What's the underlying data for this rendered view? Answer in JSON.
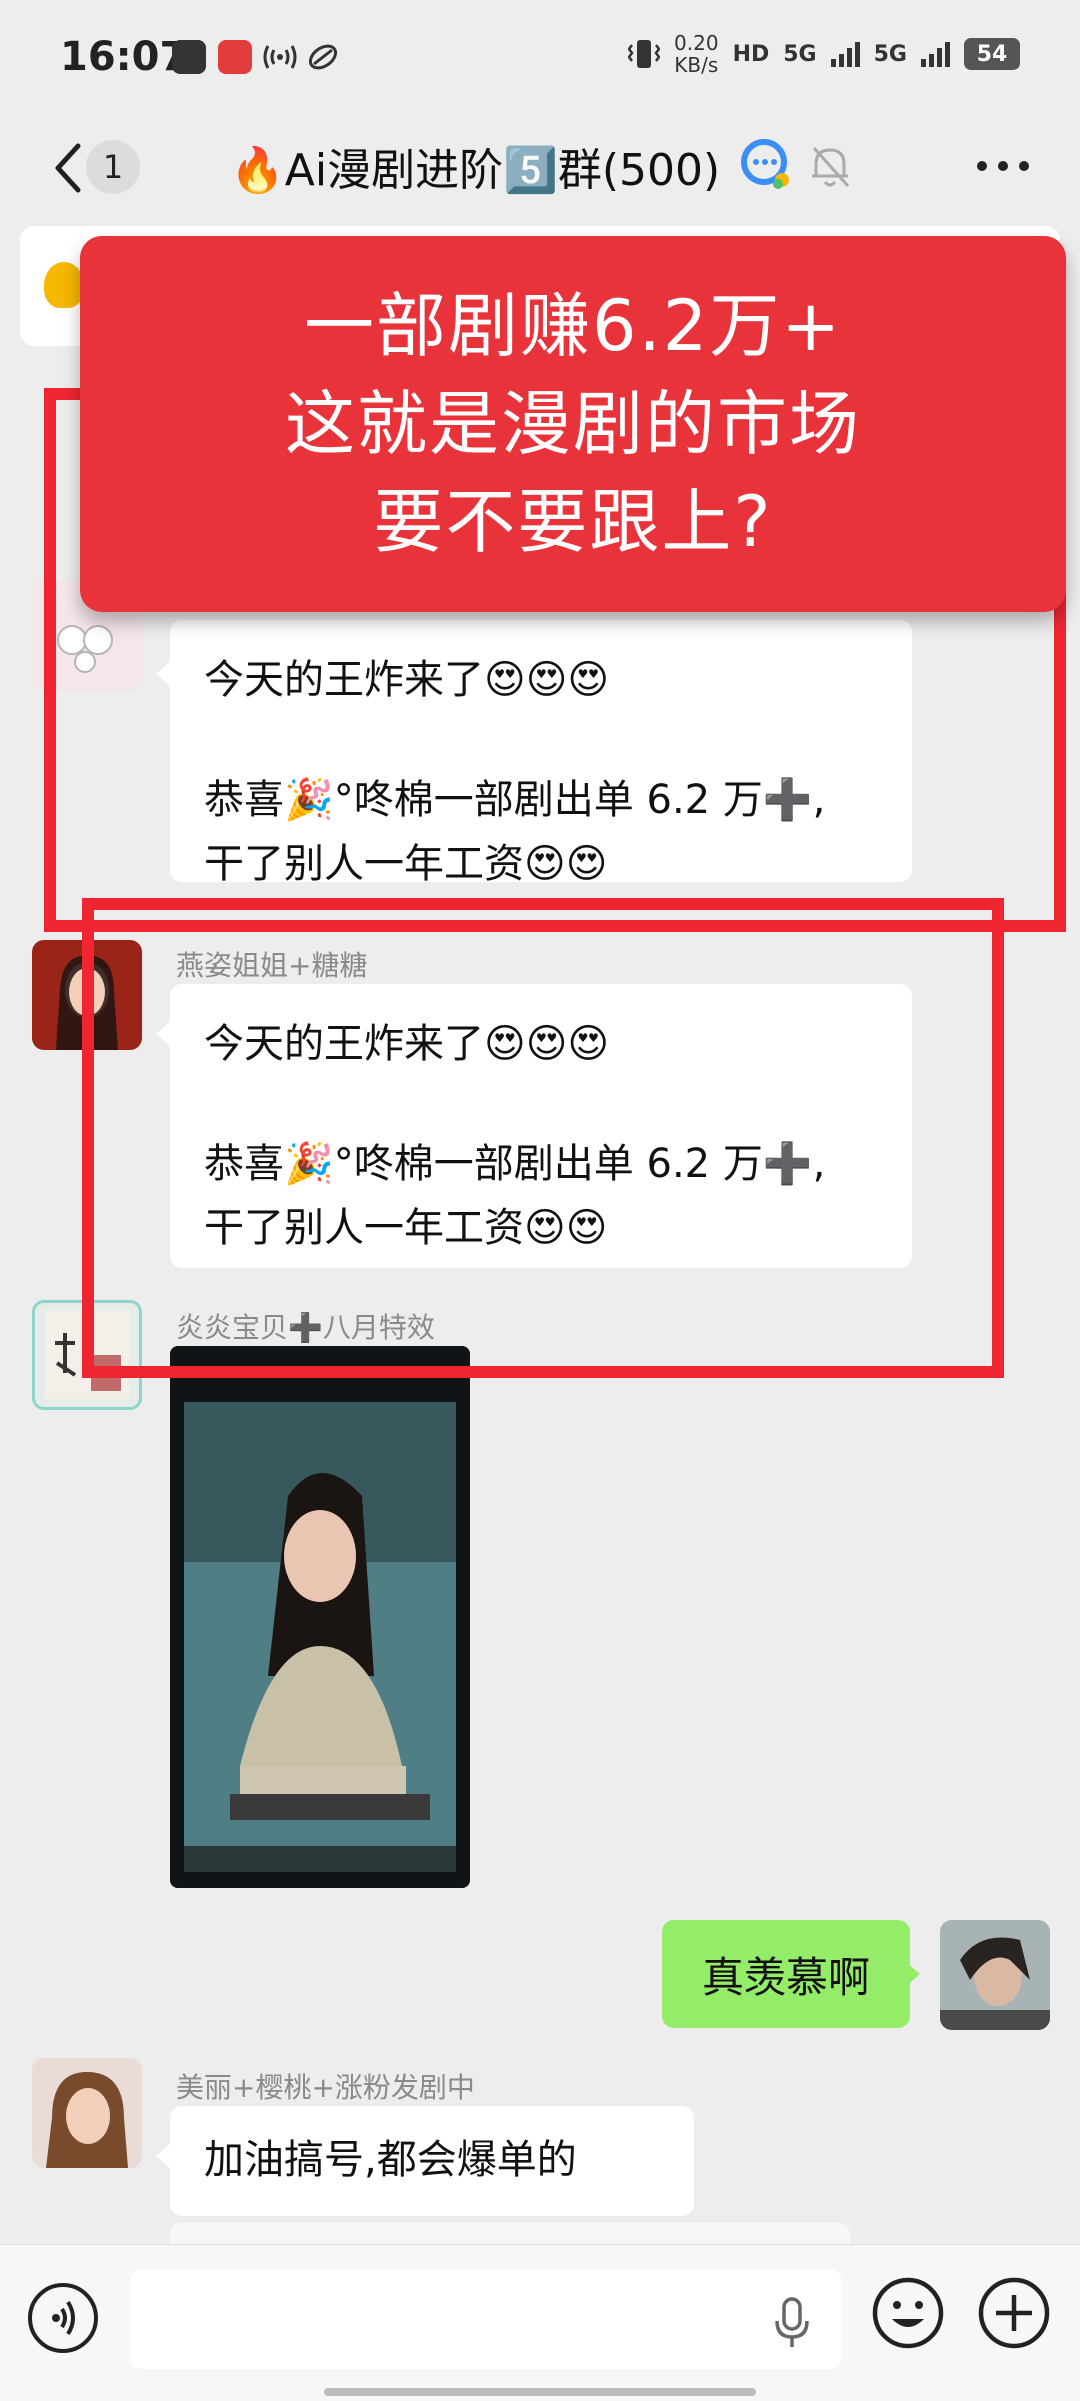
{
  "status_bar": {
    "time": "16:07",
    "net_speed_value": "0.20",
    "net_speed_unit": "KB/s",
    "hd_label": "HD",
    "sim1_label": "5G",
    "sim2_label": "5G",
    "battery_level": "54"
  },
  "header": {
    "unread_count": "1",
    "title": "🔥Ai漫剧进阶5️⃣群(500)"
  },
  "overlay_banner": {
    "line1": "一部剧赚6.2万+",
    "line2": "这就是漫剧的市场",
    "line3": "要不要跟上?"
  },
  "messages": [
    {
      "sender": "",
      "line1": "今天的王炸来了😍😍😍",
      "line2": "恭喜🎉°咚棉一部剧出单 6.2 万➕,",
      "line3": "干了别人一年工资😍😍"
    },
    {
      "sender": "燕姿姐姐+糖糖",
      "line1": "今天的王炸来了😍😍😍",
      "line2": "恭喜🎉°咚棉一部剧出单 6.2 万➕,",
      "line3": "干了别人一年工资😍😍"
    },
    {
      "sender": "炎炎宝贝➕八月特效"
    },
    {
      "text": "真羡慕啊"
    },
    {
      "sender": "美丽+樱桃+涨粉发剧中",
      "text": "加油搞号,都会爆单的"
    }
  ],
  "colors": {
    "overlay_red": "#e8333b",
    "highlight_red": "#ef2631",
    "self_bubble_green": "#95ec69",
    "chat_background": "#ededed"
  }
}
